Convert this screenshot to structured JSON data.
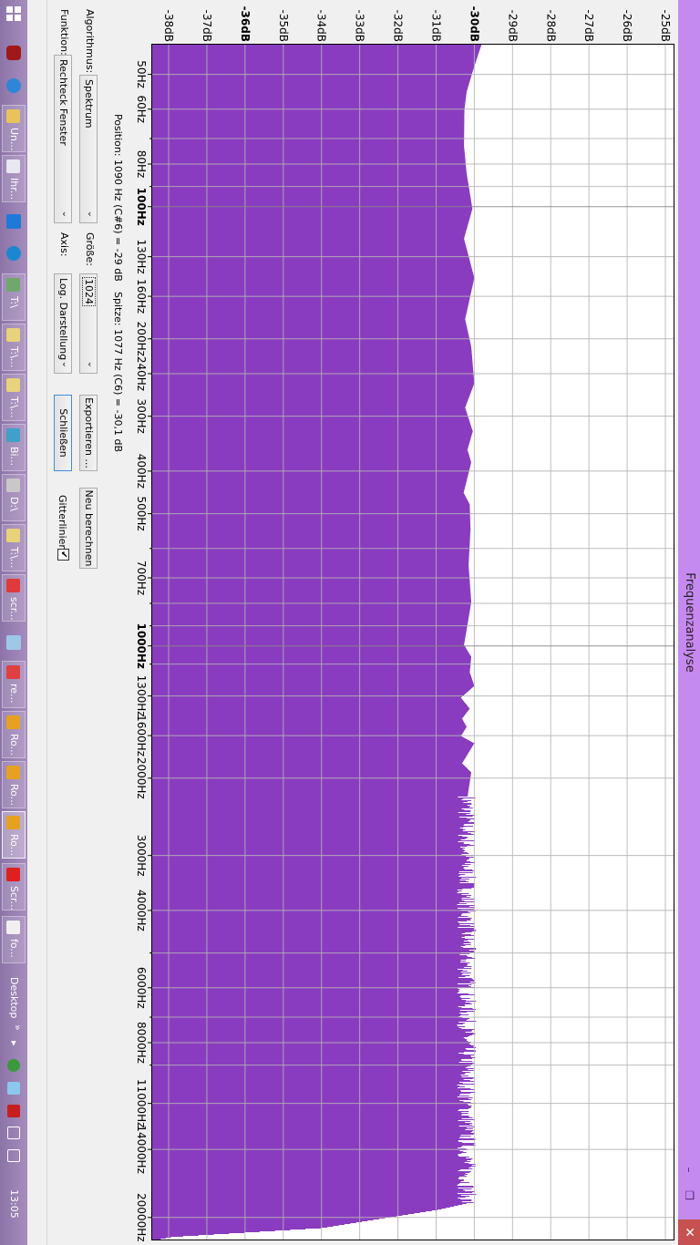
{
  "window": {
    "title": "Frequenzanalyse",
    "minimize_icon": "minimize-icon",
    "maximize_icon": "restore-icon",
    "close_label": "✕"
  },
  "colors": {
    "titlebar": "#c58af0",
    "spectrum_fill": "#8a3cc0",
    "close": "#c75050",
    "grid": "#b4b4b4"
  },
  "plot": {
    "db_ticks": [
      {
        "value": -25,
        "label": "-25dB",
        "bold": false
      },
      {
        "value": -26,
        "label": "-26dB",
        "bold": false
      },
      {
        "value": -27,
        "label": "-27dB",
        "bold": false
      },
      {
        "value": -28,
        "label": "-28dB",
        "bold": false
      },
      {
        "value": -29,
        "label": "-29dB",
        "bold": false
      },
      {
        "value": -30,
        "label": "-30dB",
        "bold": true
      },
      {
        "value": -31,
        "label": "-31dB",
        "bold": false
      },
      {
        "value": -32,
        "label": "-32dB",
        "bold": false
      },
      {
        "value": -33,
        "label": "-33dB",
        "bold": false
      },
      {
        "value": -34,
        "label": "-34dB",
        "bold": false
      },
      {
        "value": -35,
        "label": "-35dB",
        "bold": false
      },
      {
        "value": -36,
        "label": "-36dB",
        "bold": true
      },
      {
        "value": -37,
        "label": "-37dB",
        "bold": false
      },
      {
        "value": -38,
        "label": "-38dB",
        "bold": false
      }
    ],
    "db_range": [
      -38.43,
      -24.76
    ],
    "freq_range": [
      42.6,
      22500
    ],
    "freq_labels": [
      {
        "value": 50,
        "label": "50Hz",
        "bold": false
      },
      {
        "value": 60,
        "label": "60Hz",
        "bold": false
      },
      {
        "value": 80,
        "label": "80Hz",
        "bold": false
      },
      {
        "value": 100,
        "label": "100Hz",
        "bold": true
      },
      {
        "value": 130,
        "label": "130Hz",
        "bold": false
      },
      {
        "value": 160,
        "label": "160Hz",
        "bold": false
      },
      {
        "value": 200,
        "label": "200Hz",
        "bold": false
      },
      {
        "value": 240,
        "label": "240Hz",
        "bold": false
      },
      {
        "value": 300,
        "label": "300Hz",
        "bold": false
      },
      {
        "value": 400,
        "label": "400Hz",
        "bold": false
      },
      {
        "value": 500,
        "label": "500Hz",
        "bold": false
      },
      {
        "value": 700,
        "label": "700Hz",
        "bold": false
      },
      {
        "value": 1000,
        "label": "1000Hz",
        "bold": true
      },
      {
        "value": 1300,
        "label": "1300Hz",
        "bold": false
      },
      {
        "value": 1600,
        "label": "1600Hz",
        "bold": false
      },
      {
        "value": 2000,
        "label": "2000Hz",
        "bold": false
      },
      {
        "value": 3000,
        "label": "3000Hz",
        "bold": false
      },
      {
        "value": 4000,
        "label": "4000Hz",
        "bold": false
      },
      {
        "value": 6000,
        "label": "6000Hz",
        "bold": false
      },
      {
        "value": 8000,
        "label": "8000Hz",
        "bold": false
      },
      {
        "value": 11000,
        "label": "11000Hz",
        "bold": false
      },
      {
        "value": 14000,
        "label": "14000Hz",
        "bold": false
      },
      {
        "value": 20000,
        "label": "20000Hz",
        "bold": false
      }
    ],
    "freq_grid_minor": [
      70,
      90,
      600,
      800,
      900,
      1100,
      5000,
      7000,
      9000
    ],
    "spectrum_points": [
      [
        42.4,
        -29.8
      ],
      [
        47.8,
        -30.0
      ],
      [
        54.6,
        -30.2
      ],
      [
        60.1,
        -30.26
      ],
      [
        72.7,
        -30.27
      ],
      [
        83.9,
        -30.2
      ],
      [
        100.9,
        -30.05
      ],
      [
        118,
        -30.27
      ],
      [
        145,
        -30.0
      ],
      [
        180,
        -30.24
      ],
      [
        208,
        -30.08
      ],
      [
        252,
        -30.0
      ],
      [
        286,
        -30.24
      ],
      [
        324,
        -30.04
      ],
      [
        357,
        -30.18
      ],
      [
        381,
        -30.08
      ],
      [
        447,
        -30.28
      ],
      [
        475,
        -30.12
      ],
      [
        541,
        -30.1
      ],
      [
        654,
        -30.15
      ],
      [
        793,
        -30.08
      ],
      [
        915,
        -30.2
      ],
      [
        992,
        -30.27
      ],
      [
        1056,
        -30.08
      ],
      [
        1145,
        -30.12
      ],
      [
        1230,
        -30.0
      ],
      [
        1309,
        -30.35
      ],
      [
        1386,
        -30.12
      ],
      [
        1460,
        -30.32
      ],
      [
        1525,
        -30.2
      ],
      [
        1600,
        -30.35
      ],
      [
        1662,
        -30.0
      ],
      [
        1846,
        -30.32
      ],
      [
        1936,
        -30.08
      ],
      [
        2265,
        -30.2
      ],
      [
        18540,
        -30.2
      ],
      [
        19170,
        -30.95
      ],
      [
        20100,
        -32.47
      ],
      [
        21090,
        -33.98
      ],
      [
        22100,
        -37.9
      ],
      [
        22500,
        -38.4
      ]
    ],
    "noisy_band_hz": [
      2200,
      18500
    ]
  },
  "status": {
    "position": "Position: 1090 Hz (C#6) = -29 dB",
    "peak": "Spitze: 1077 Hz (C6) = -30,1 dB"
  },
  "controls": {
    "algorithm_label": "Algorithmus:",
    "algorithm_value": "Spektrum",
    "size_label": "Größe:",
    "size_value": "1024",
    "export_button": "Exportieren ...",
    "recalc_button": "Neu berechnen",
    "function_label": "Funktion:",
    "function_value": "Rechteck Fenster",
    "axis_label": "Axis:",
    "axis_value": "Log. Darstellung",
    "close_button": "Schließen",
    "gridlines_label": "Gitterlinien",
    "gridlines_checked": true,
    "chevron": "⌄"
  },
  "taskbar": {
    "items": [
      {
        "label": "Un...",
        "icon": "image-viewer-icon",
        "color": "#e8c35a"
      },
      {
        "label": "Ihr...",
        "icon": "mail-icon",
        "color": "#e8e8f0"
      },
      {
        "label": "T:\\",
        "icon": "cd-icon",
        "color": "#6fa86a"
      },
      {
        "label": "T:\\...",
        "icon": "folder-icon",
        "color": "#e8d27a"
      },
      {
        "label": "T:\\...",
        "icon": "folder-icon",
        "color": "#e8d27a"
      },
      {
        "label": "Bi...",
        "icon": "picture-icon",
        "color": "#3fa0c8"
      },
      {
        "label": "D:\\",
        "icon": "drive-icon",
        "color": "#c8c8c8"
      },
      {
        "label": "T:\\...",
        "icon": "folder-icon",
        "color": "#e8d27a"
      },
      {
        "label": "scr...",
        "icon": "vivaldi-icon",
        "color": "#e03a3a"
      },
      {
        "label": "re...",
        "icon": "pdf-icon",
        "color": "#e04040"
      },
      {
        "label": "Ro...",
        "icon": "headphones-icon",
        "color": "#e6a21e"
      },
      {
        "label": "Ro...",
        "icon": "headphones-icon",
        "color": "#e6a21e"
      },
      {
        "label": "Ro...",
        "icon": "headphones-icon",
        "color": "#e6a21e"
      },
      {
        "label": "Scr...",
        "icon": "screenshot-icon",
        "color": "#e02020"
      },
      {
        "label": "fo...",
        "icon": "foobar-icon",
        "color": "#f0f0f0"
      }
    ],
    "active_index": 12,
    "desktop_label": "Desktop",
    "more_label": "»",
    "tray_expand": "▸",
    "clock": "13:05"
  }
}
